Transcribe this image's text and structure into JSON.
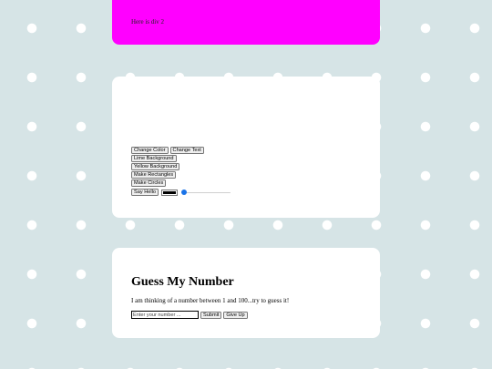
{
  "div2": {
    "label": "Here is div 2",
    "background": "#ff00ff"
  },
  "controls": {
    "change_color": "Change Color",
    "change_text": "Change Text",
    "lime_background": "Lime Background",
    "yellow_background": "Yellow Background",
    "make_rectangles": "Make Rectangles",
    "make_circles": "Make Circles",
    "say_hello": "Say Hello",
    "color_value": "#000000",
    "slider_value": 0
  },
  "guess": {
    "title": "Guess My Number",
    "description": "I am thinking of a number between 1 and 100...try to guess it!",
    "input_placeholder": "Enter your number ...",
    "input_value": "",
    "submit": "Submit",
    "give_up": "Give Up"
  },
  "colors": {
    "page_background": "#d6e4e6",
    "dot": "#ffffff",
    "card": "#ffffff",
    "accent_div": "#ff00ff",
    "slider_thumb": "#1a73e8"
  }
}
